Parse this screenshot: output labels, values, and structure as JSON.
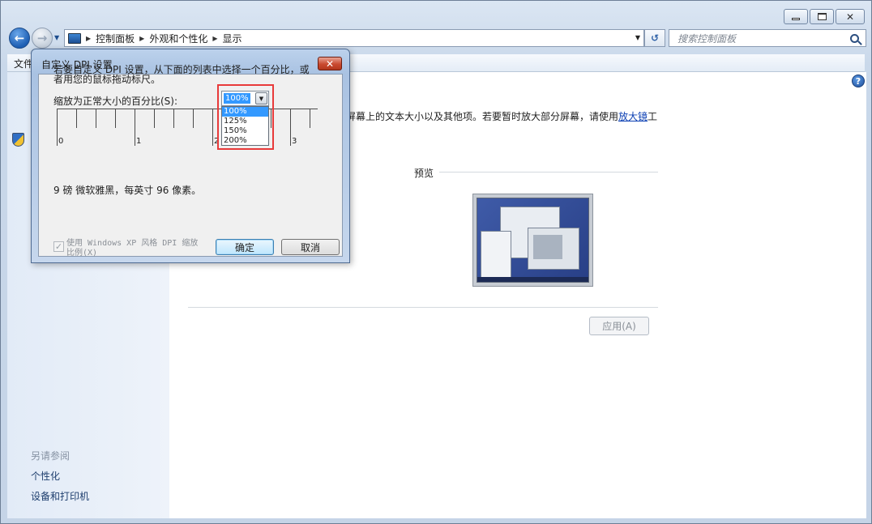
{
  "window": {
    "breadcrumbs": [
      "控制面板",
      "外观和个性化",
      "显示"
    ],
    "search_placeholder": "搜索控制面板",
    "menu": {
      "file": "文件"
    }
  },
  "left_pane": {
    "see_also": "另请参阅",
    "links": [
      "个性化",
      "设备和打印机"
    ]
  },
  "main": {
    "description": "屏幕上的文本大小以及其他项。若要暂时放大部分屏幕，请使用",
    "magnifier_link": "放大镜",
    "description_tail": "工",
    "preview_label": "预览",
    "apply_button": "应用(A)"
  },
  "dialog": {
    "title": "自定义 DPI 设置",
    "intro": "若要自定义 DPI 设置，从下面的列表中选择一个百分比，或者用您的鼠标拖动标尺。",
    "scale_label": "缩放为正常大小的百分比(S):",
    "selected_value": "100%",
    "options": [
      "100%",
      "125%",
      "150%",
      "200%"
    ],
    "selected_index": 0,
    "ruler_labels": [
      "0",
      "1",
      "2",
      "3"
    ],
    "font_info": "9 磅 微软雅黑，每英寸 96 像素。",
    "xp_checkbox_label": "使用 Windows XP 风格 DPI 缩放比例(X)",
    "xp_checked": true,
    "ok_button": "确定",
    "cancel_button": "取消"
  },
  "colors": {
    "accent": "#3399ff",
    "highlight_frame": "#e83a3a",
    "link": "#0b3fb3",
    "close_red": "#c94a30"
  }
}
